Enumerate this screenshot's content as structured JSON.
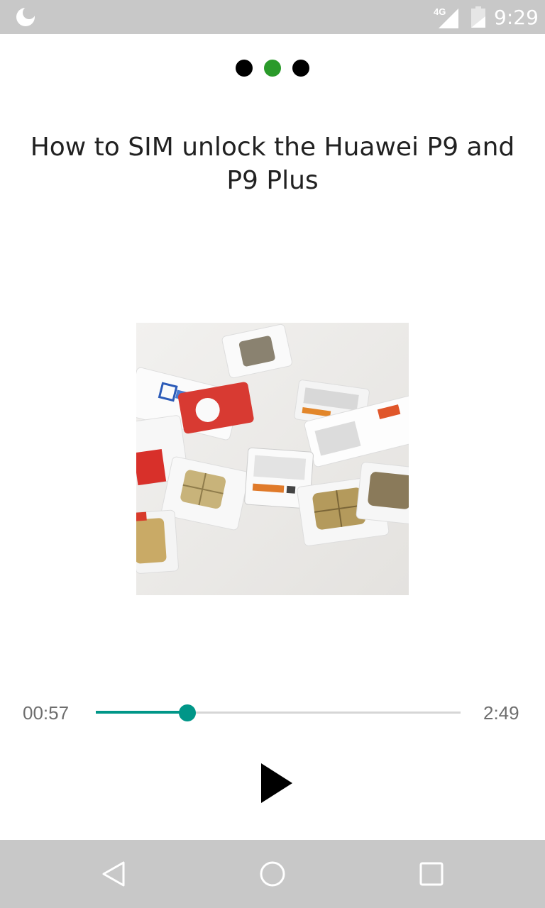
{
  "status_bar": {
    "network_type": "4G",
    "time": "9:29",
    "icons": [
      "moon-icon",
      "signal-icon",
      "battery-icon"
    ]
  },
  "pager": {
    "count": 3,
    "active_index": 1,
    "active_color": "#2a9a2a"
  },
  "episode": {
    "title": "How to SIM unlock the Huawei P9 and P9 Plus"
  },
  "player": {
    "elapsed": "00:57",
    "duration": "2:49",
    "progress_fraction": 0.25,
    "accent_color": "#009688",
    "play_icon": "play-icon"
  },
  "nav_bar": {
    "icons": [
      "back-icon",
      "home-icon",
      "recents-icon"
    ]
  }
}
